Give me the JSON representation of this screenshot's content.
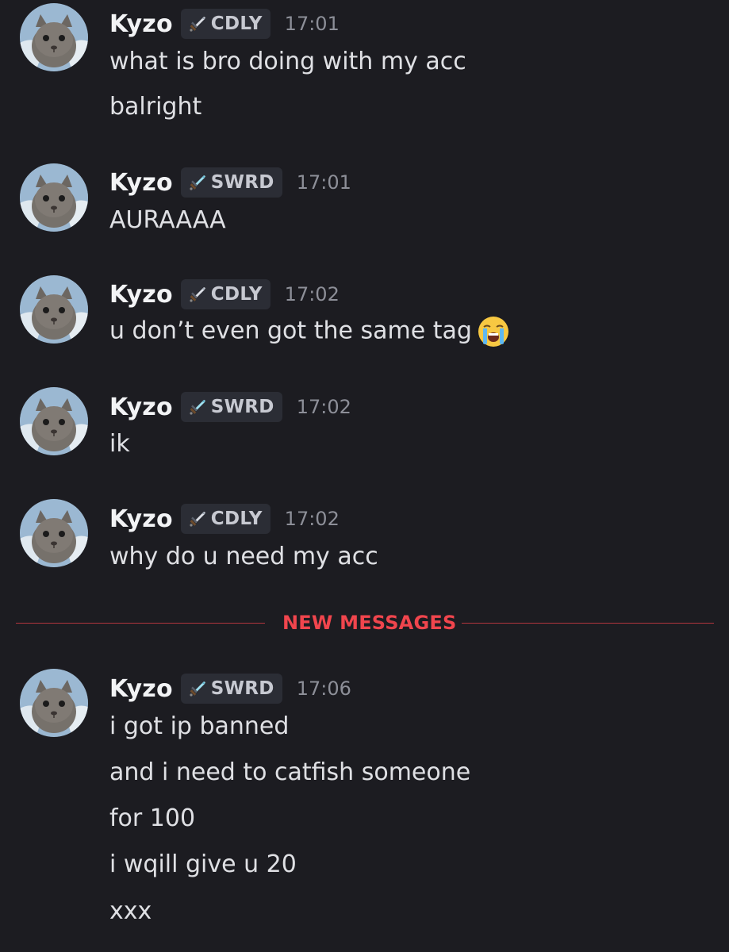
{
  "colors": {
    "background": "#1c1c21",
    "username": "#f2f3f5",
    "tag_background": "#2b2d35",
    "timestamp": "#8d8f98",
    "new_messages": "#f0454d"
  },
  "messages": [
    {
      "author": "Kyzo",
      "tag": "CDLY",
      "tag_icon": "sword-icon",
      "time": "17:01",
      "lines": [
        "what is bro doing with my acc",
        "balright"
      ]
    },
    {
      "author": "Kyzo",
      "tag": "SWRD",
      "tag_icon": "sword-icon",
      "time": "17:01",
      "lines": [
        "AURAAAA"
      ]
    },
    {
      "author": "Kyzo",
      "tag": "CDLY",
      "tag_icon": "sword-icon",
      "time": "17:02",
      "lines": [
        "u don’t even got the same tag"
      ],
      "emoji": "loudly-crying-face-emoji"
    },
    {
      "author": "Kyzo",
      "tag": "SWRD",
      "tag_icon": "sword-icon",
      "time": "17:02",
      "lines": [
        "ik"
      ]
    },
    {
      "author": "Kyzo",
      "tag": "CDLY",
      "tag_icon": "sword-icon",
      "time": "17:02",
      "lines": [
        "why do u need my acc"
      ]
    },
    {
      "author": "Kyzo",
      "tag": "SWRD",
      "tag_icon": "sword-icon",
      "time": "17:06",
      "lines": [
        "i got ip banned",
        "and i need to catfish someone",
        "for 100",
        "i wqill give u 20",
        "xxx"
      ]
    }
  ],
  "divider": {
    "label": "NEW MESSAGES"
  }
}
